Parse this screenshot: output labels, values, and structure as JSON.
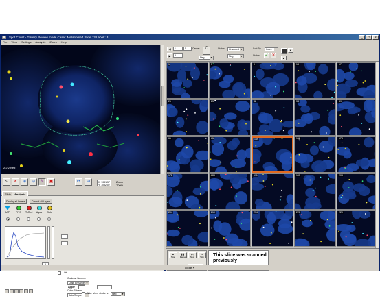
{
  "window": {
    "title": "Spot Count - Gallery Review mode   Case : Melanoma4   Slide : 3   Label : 3",
    "minimize": "_",
    "maximize": "□",
    "close": "×"
  },
  "menu": [
    "File",
    "View",
    "Settings",
    "Analysis",
    "Zoom",
    "Help"
  ],
  "viewer": {
    "probe_label": "2  2  2  Neg"
  },
  "toolbar": {
    "readout_lines": [
      "X: 1081.57",
      "Y: 1082.02",
      "Z: 4.0"
    ],
    "zoom_label": "Zoom",
    "zoom_value": "700%"
  },
  "tabs": [
    "Slide",
    "Analysis"
  ],
  "analysis": {
    "display_all_button": "Display all Layers",
    "control_all_button": "Control all Layers",
    "probes": [
      {
        "name": "DAPI",
        "color": "#1aa0e6",
        "shape": "triangle"
      },
      {
        "name": "FITC",
        "color": "#2fcc2f",
        "shape": "circle"
      },
      {
        "name": "TxRed",
        "color": "#e02020",
        "shape": "circle"
      },
      {
        "name": "Aqua",
        "color": "#34d6d6",
        "shape": "circle"
      },
      {
        "name": "Gold",
        "color": "#e6c21a",
        "shape": "circle"
      }
    ],
    "bottom_number": "0",
    "chk_label": "Link",
    "contrast_label": "Contrast Scheme",
    "contrast_value": "Cust. Enhanced",
    "apply_label": "Apply",
    "color_scheme_label": "Color Scheme",
    "color_scheme_value": "Auto/Simple",
    "stack_label": "1",
    "filter_label": "Filter when strobe is",
    "filter_value": "Neg"
  },
  "right_toolbar": {
    "step_value": "1",
    "stop_value": "5",
    "field_value": "5",
    "center_label": "Center",
    "combo_value": "Neg",
    "status_label": "Status",
    "status_value": "Unscored",
    "status_value2": "Neg",
    "sort_label": "Sort By",
    "sort_value": "Index",
    "status2_label": "Status"
  },
  "grid": {
    "cells": [
      {
        "num": "1"
      },
      {
        "num": "5"
      },
      {
        "num": "9"
      },
      {
        "num": "13"
      },
      {
        "num": "17"
      },
      {
        "num": "21"
      },
      {
        "num": "25"
      },
      {
        "num": "32"
      },
      {
        "num": "38"
      },
      {
        "num": "49"
      },
      {
        "num": "61"
      },
      {
        "num": "65"
      },
      {
        "num": "149"
      },
      {
        "num": "162"
      },
      {
        "num": "173"
      },
      {
        "num": "178"
      },
      {
        "num": "183"
      },
      {
        "num": "191"
      },
      {
        "num": "195"
      },
      {
        "num": "203"
      },
      {
        "num": "204"
      },
      {
        "num": "210"
      },
      {
        "num": "214"
      },
      {
        "num": "221"
      },
      {
        "num": "229"
      }
    ],
    "selected_index": 12
  },
  "bottom": {
    "controls": [
      "Stop",
      "Pause",
      "Next",
      "Skip"
    ],
    "time": "00:00:00",
    "cancel": "Cancel",
    "message": "This slide was scanned previously"
  },
  "status_bar": "Locale   ▼"
}
